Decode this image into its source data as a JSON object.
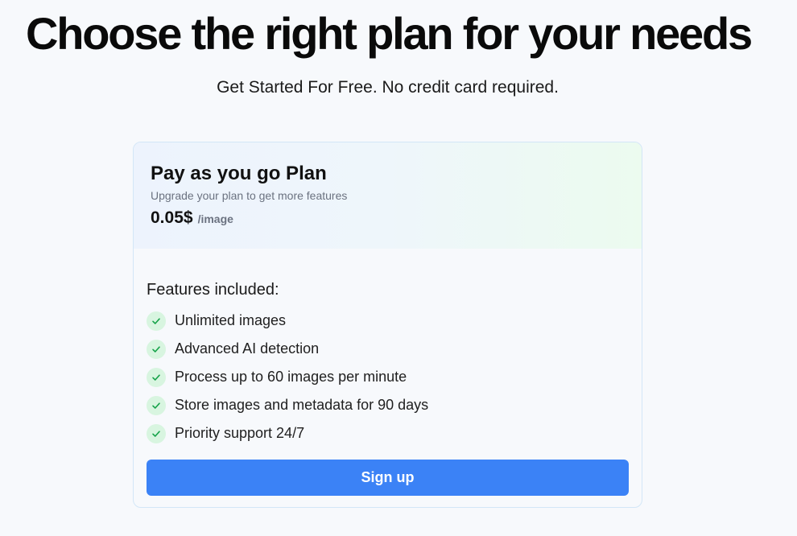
{
  "header": {
    "title": "Choose the right plan for your needs",
    "subtitle": "Get Started For Free. No credit card required."
  },
  "plan": {
    "name": "Pay as you go Plan",
    "description": "Upgrade your plan to get more features",
    "price": "0.05$",
    "unit": "/image",
    "features_title": "Features included:",
    "features": [
      {
        "label": "Unlimited images",
        "icon": "check-icon"
      },
      {
        "label": "Advanced AI detection",
        "icon": "check-icon"
      },
      {
        "label": "Process up to 60 images per minute",
        "icon": "check-icon"
      },
      {
        "label": "Store images and metadata for 90 days",
        "icon": "check-icon"
      },
      {
        "label": "Priority support 24/7",
        "icon": "check-icon"
      }
    ],
    "cta_label": "Sign up"
  },
  "colors": {
    "accent": "#3b82f6",
    "check_bg": "#d8f5e0",
    "check_mark": "#16a34a",
    "muted_text": "#6b7280"
  }
}
